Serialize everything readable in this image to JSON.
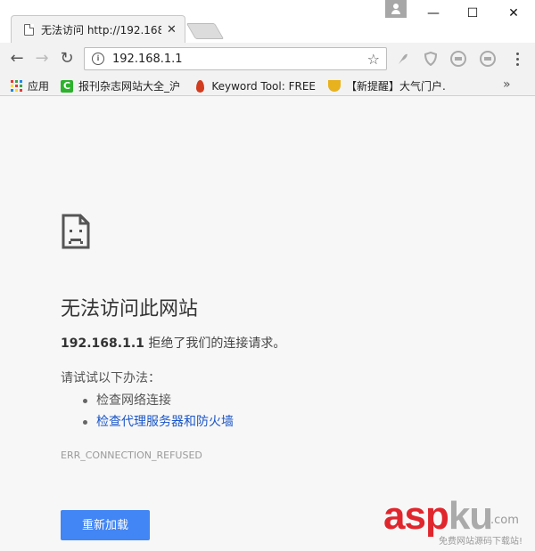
{
  "window": {
    "tab_title": "无法访问 http://192.168",
    "tab_close": "✕",
    "minimize": "—",
    "maximize": "☐",
    "close": "✕"
  },
  "toolbar": {
    "back": "←",
    "forward": "→",
    "reload": "↻",
    "url": "192.168.1.1",
    "info": "i",
    "star": "☆",
    "menu_icon": "more-vertical-icon"
  },
  "bookmarks": {
    "items": [
      {
        "label": "应用",
        "icon": "apps-grid-icon"
      },
      {
        "label": "报刊杂志网站大全_沪",
        "icon": "c-icon"
      },
      {
        "label": "Keyword Tool: FREE",
        "icon": "flame-icon"
      },
      {
        "label": "【新提醒】大气门户.",
        "icon": "trophy-icon"
      }
    ],
    "overflow": "»"
  },
  "error_page": {
    "heading": "无法访问此网站",
    "host": "192.168.1.1",
    "message_rest": " 拒绝了我们的连接请求。",
    "suggest_title": "请试试以下办法：",
    "suggestions": [
      "检查网络连接",
      "检查代理服务器和防火墙"
    ],
    "error_code": "ERR_CONNECTION_REFUSED",
    "reload_label": "重新加载"
  },
  "watermark": {
    "main_asp": "asp",
    "main_ku": "ku",
    "com": ".com",
    "sub": "免费网站源码下载站!"
  },
  "colors": {
    "accent": "#4285f4",
    "link": "#1a55c7",
    "watermark_red": "#e0262d"
  }
}
